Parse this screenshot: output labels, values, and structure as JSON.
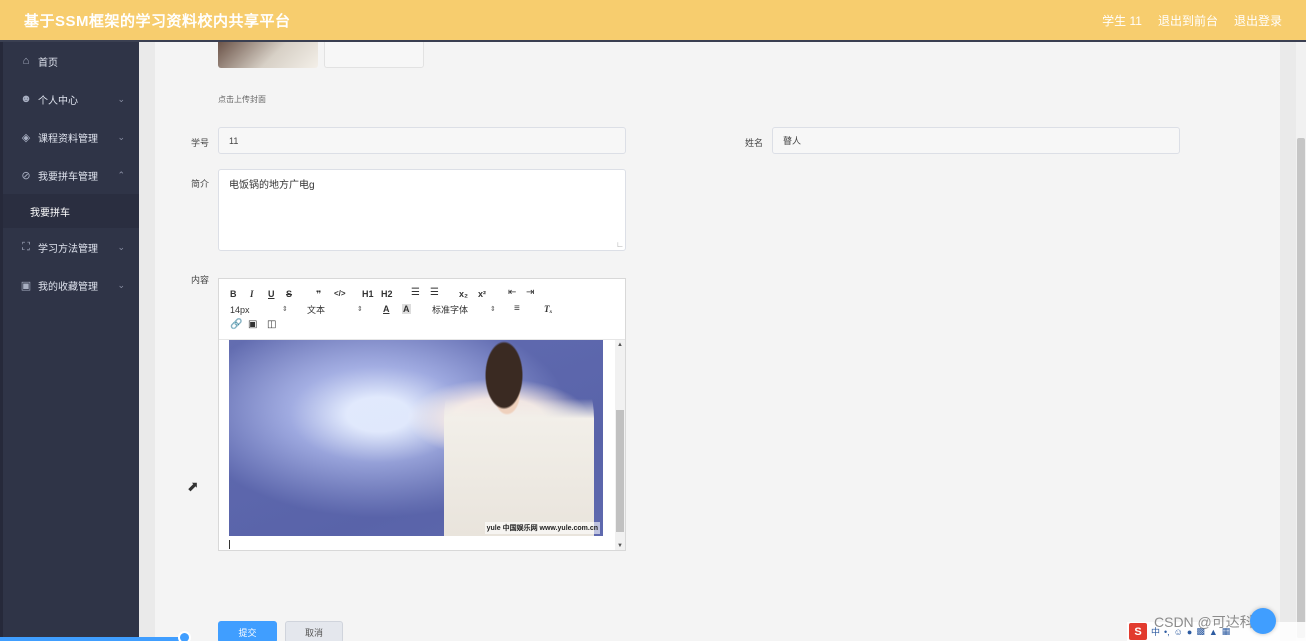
{
  "header": {
    "title": "基于SSM框架的学习资料校内共享平台",
    "user": "学生 11",
    "back_to_front": "退出到前台",
    "logout": "退出登录"
  },
  "sidebar": {
    "items": [
      {
        "label": "首页",
        "icon": "home-icon"
      },
      {
        "label": "个人中心",
        "icon": "user-icon"
      },
      {
        "label": "课程资料管理",
        "icon": "compass-icon"
      },
      {
        "label": "我要拼车管理",
        "icon": "slash-circle-icon"
      },
      {
        "label": "学习方法管理",
        "icon": "fullscreen-icon"
      },
      {
        "label": "我的收藏管理",
        "icon": "briefcase-icon"
      }
    ],
    "submenu": {
      "label": "我要拼车"
    }
  },
  "form": {
    "upload_hint": "点击上传封面",
    "student_no_label": "学号",
    "student_no_value": "11",
    "name_label": "姓名",
    "name_value": "瞽人",
    "intro_label": "简介",
    "intro_value": "电饭锅的地方广电g",
    "content_label": "内容",
    "submit_label": "提交",
    "cancel_label": "取消"
  },
  "editor": {
    "toolbar_row1": [
      "B",
      "I",
      "U",
      "S",
      "❞",
      "</>",
      "H1",
      "H2",
      "ol",
      "ul",
      "x₂",
      "x²",
      "outdent",
      "indent"
    ],
    "font_size": "14px",
    "text_type": "文本",
    "font_family": "标准字体",
    "image_watermark": "yule 中国娱乐网 www.yule.com.cn"
  },
  "overlay": {
    "csdn_watermark": "CSDN @可达科技I",
    "ime_logo": "S",
    "ime_mode": "中"
  }
}
